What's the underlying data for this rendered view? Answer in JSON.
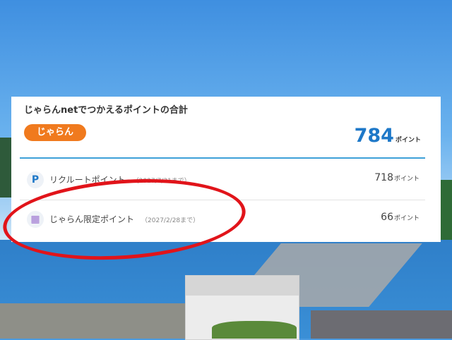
{
  "card": {
    "title": "じゃらんnetでつかえるポイントの合計",
    "logo_text": "じゃらん",
    "total_value": "784",
    "total_unit": "ポイント"
  },
  "rows": [
    {
      "icon": "recruit-point-icon",
      "label": "リクルートポイント",
      "expiry": "（2027/7/31まで）",
      "value": "718",
      "unit": "ポイント"
    },
    {
      "icon": "gift-icon",
      "label": "じゃらん限定ポイント",
      "expiry": "（2027/2/28まで）",
      "value": "66",
      "unit": "ポイント"
    }
  ],
  "colors": {
    "accent_blue": "#1e78c8",
    "logo_orange": "#f07a1e",
    "highlight_red": "#e1141a"
  }
}
